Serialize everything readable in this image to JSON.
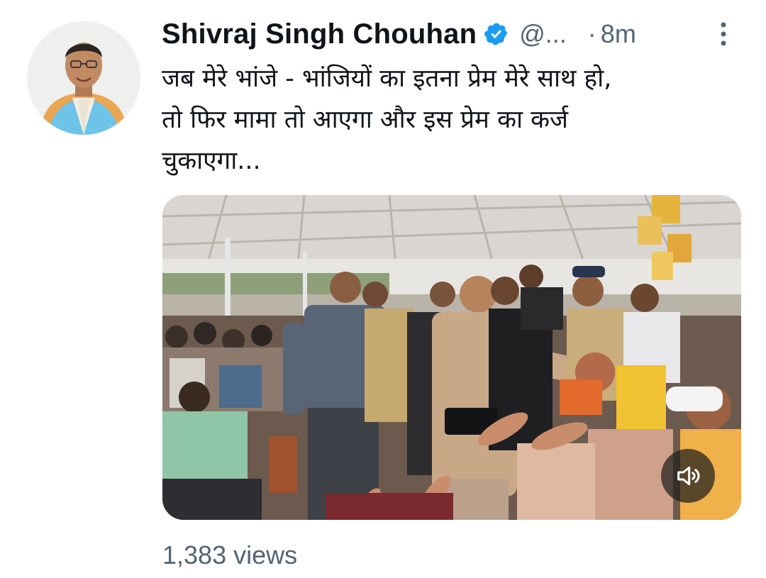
{
  "tweet": {
    "author_name": "Shivraj Singh Chouhan",
    "handle": "@...",
    "separator": "·",
    "timestamp": "8m",
    "text_lines": [
      "जब मेरे भांजे - भांजियों का इतना प्रेम मेरे साथ हो,",
      "तो फिर मामा तो आएगा और इस प्रेम का कर्ज",
      "चुकाएगा..."
    ],
    "views": "1,383 views"
  },
  "icons": {
    "verified": "verified-badge-icon",
    "more": "more-vertical-icon",
    "mute": "speaker-muted-icon"
  },
  "colors": {
    "verified_blue": "#1d9bf0",
    "secondary_text": "#536471",
    "primary_text": "#0f1419"
  }
}
